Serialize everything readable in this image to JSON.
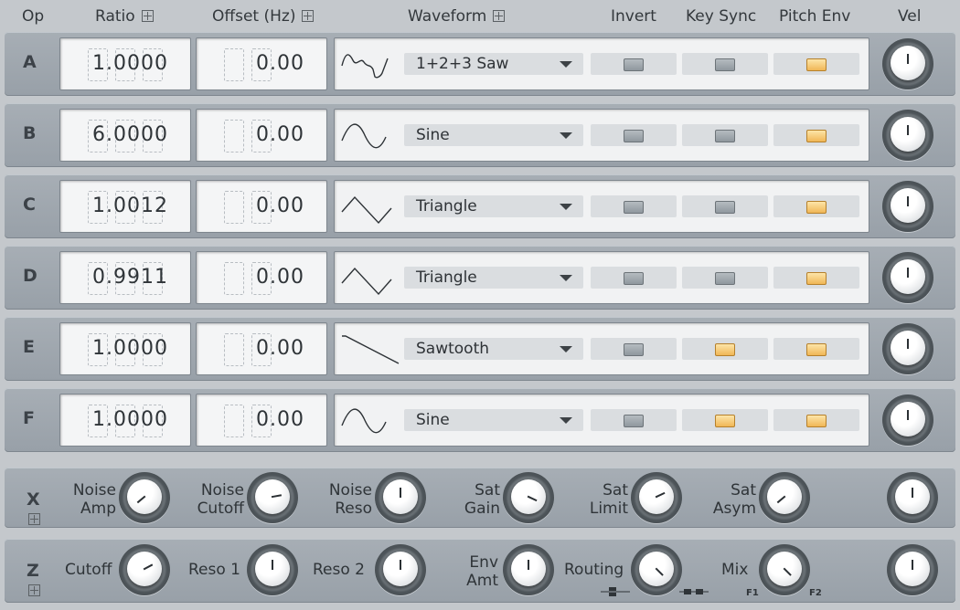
{
  "header": {
    "op": "Op",
    "ratio": "Ratio",
    "offset": "Offset (Hz)",
    "waveform": "Waveform",
    "invert": "Invert",
    "key_sync": "Key Sync",
    "pitch_env": "Pitch Env",
    "vel": "Vel"
  },
  "operators": [
    {
      "label": "A",
      "ratio": "1.0000",
      "offset": "0.00",
      "waveform": "1+2+3 Saw",
      "wave_icon": "saw-123-wave-icon",
      "invert": false,
      "key_sync": false,
      "pitch_env": true
    },
    {
      "label": "B",
      "ratio": "6.0000",
      "offset": "0.00",
      "waveform": "Sine",
      "wave_icon": "sine-wave-icon",
      "invert": false,
      "key_sync": false,
      "pitch_env": true
    },
    {
      "label": "C",
      "ratio": "1.0012",
      "offset": "0.00",
      "waveform": "Triangle",
      "wave_icon": "triangle-wave-icon",
      "invert": false,
      "key_sync": false,
      "pitch_env": true
    },
    {
      "label": "D",
      "ratio": "0.9911",
      "offset": "0.00",
      "waveform": "Triangle",
      "wave_icon": "triangle-wave-icon",
      "invert": false,
      "key_sync": false,
      "pitch_env": true
    },
    {
      "label": "E",
      "ratio": "1.0000",
      "offset": "0.00",
      "waveform": "Sawtooth",
      "wave_icon": "sawtooth-wave-icon",
      "invert": false,
      "key_sync": true,
      "pitch_env": true
    },
    {
      "label": "F",
      "ratio": "1.0000",
      "offset": "0.00",
      "waveform": "Sine",
      "wave_icon": "sine-wave-icon",
      "invert": false,
      "key_sync": true,
      "pitch_env": true
    }
  ],
  "x_section": {
    "label": "X",
    "knobs": [
      {
        "line1": "Noise",
        "line2": "Amp"
      },
      {
        "line1": "Noise",
        "line2": "Cutoff"
      },
      {
        "line1": "Noise",
        "line2": "Reso"
      },
      {
        "line1": "Sat",
        "line2": "Gain"
      },
      {
        "line1": "Sat",
        "line2": "Limit"
      },
      {
        "line1": "Sat",
        "line2": "Asym"
      }
    ]
  },
  "z_section": {
    "label": "Z",
    "cutoff": "Cutoff",
    "reso1": "Reso 1",
    "reso2": "Reso 2",
    "env_amt_1": "Env",
    "env_amt_2": "Amt",
    "routing": "Routing",
    "mix": "Mix",
    "mix_f1": "F1",
    "mix_f2": "F2"
  },
  "colors": {
    "background": "#c4c8cc",
    "row": "#a1a8b0",
    "led_on": "#f0b656",
    "led_off": "#9aa1a7"
  }
}
